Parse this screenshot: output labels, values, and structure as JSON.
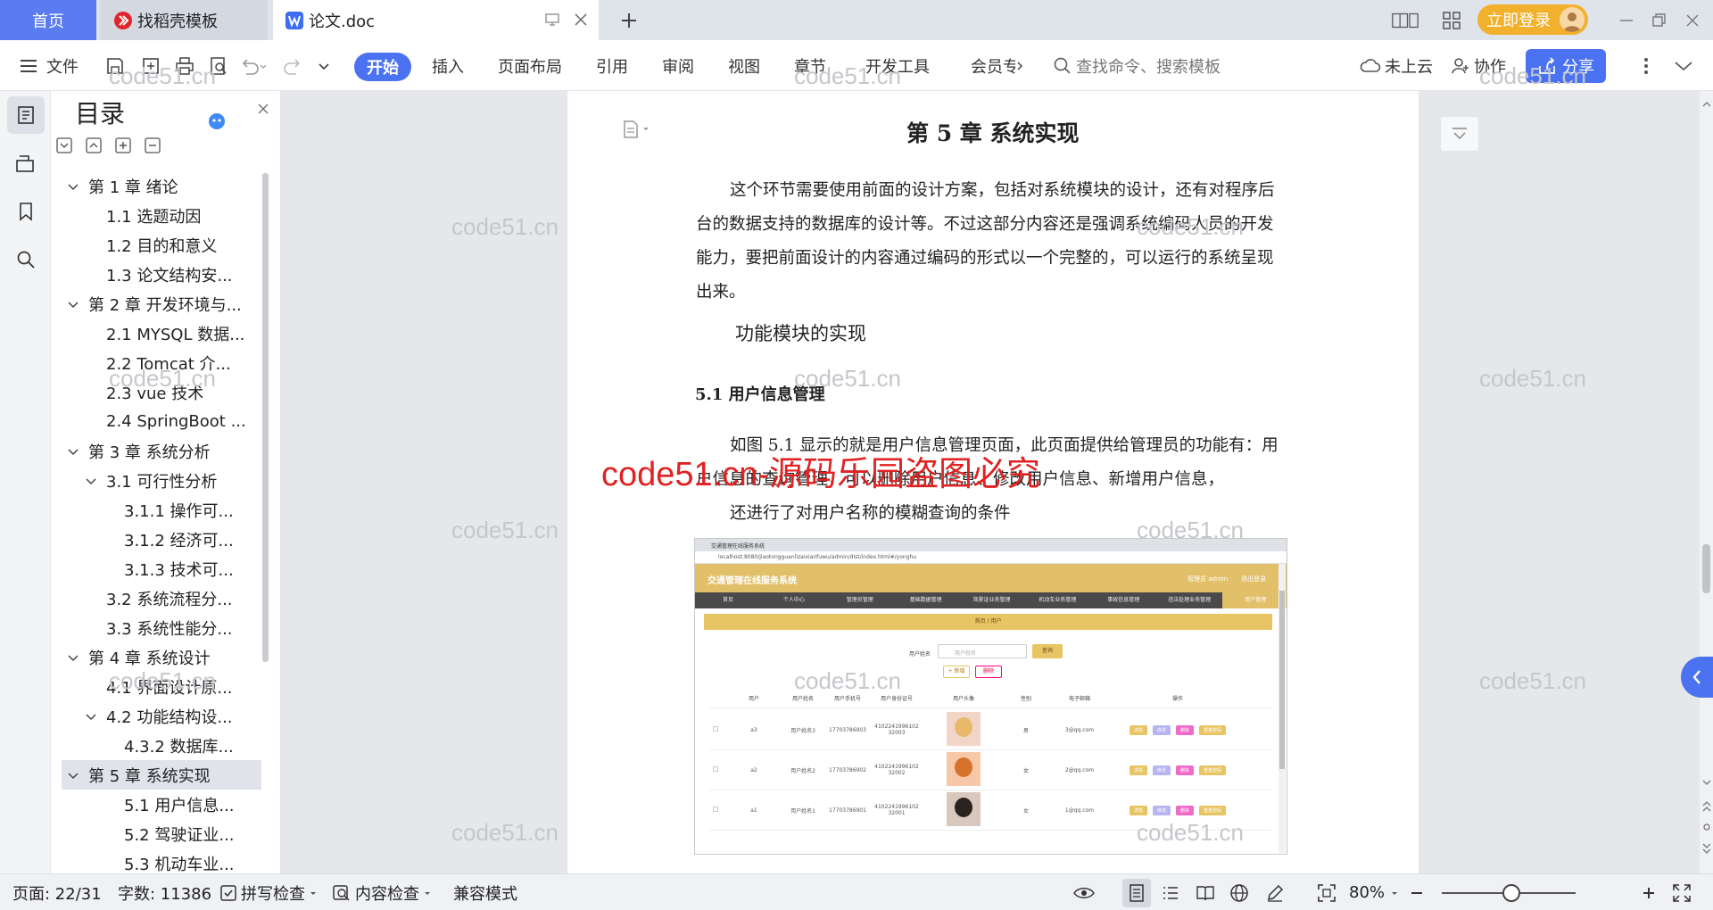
{
  "tabs": {
    "home": "首页",
    "zhaodaoke": "找稻壳模板",
    "doc": "论文.doc",
    "login": "立即登录"
  },
  "toolbar": {
    "file": "文件",
    "menus": [
      "开始",
      "插入",
      "页面布局",
      "引用",
      "审阅",
      "视图",
      "章节",
      "开发工具",
      "会员专"
    ],
    "search_placeholder": "查找命令、搜索模板",
    "cloud": "未上云",
    "collab": "协作",
    "share": "分享"
  },
  "outline": {
    "title": "目录",
    "items": [
      {
        "text": "第 1 章  绪论",
        "level": 1,
        "chev": true
      },
      {
        "text": "1.1 选题动因",
        "level": 2
      },
      {
        "text": "1.2 目的和意义",
        "level": 2
      },
      {
        "text": "1.3 论文结构安...",
        "level": 2
      },
      {
        "text": "第 2 章  开发环境与...",
        "level": 1,
        "chev": true
      },
      {
        "text": "2.1 MYSQL 数据...",
        "level": 2
      },
      {
        "text": "2.2 Tomcat 介...",
        "level": 2
      },
      {
        "text": "2.3 vue 技术",
        "level": 2
      },
      {
        "text": "2.4 SpringBoot ...",
        "level": 2
      },
      {
        "text": "第 3 章  系统分析",
        "level": 1,
        "chev": true
      },
      {
        "text": "3.1 可行性分析",
        "level": 2,
        "chev": true
      },
      {
        "text": "3.1.1 操作可...",
        "level": 3
      },
      {
        "text": "3.1.2 经济可...",
        "level": 3
      },
      {
        "text": "3.1.3 技术可...",
        "level": 3
      },
      {
        "text": "3.2 系统流程分...",
        "level": 2
      },
      {
        "text": "3.3 系统性能分...",
        "level": 2
      },
      {
        "text": "第 4 章  系统设计",
        "level": 1,
        "chev": true
      },
      {
        "text": "4.1 界面设计原...",
        "level": 2
      },
      {
        "text": "4.2 功能结构设...",
        "level": 2,
        "chev": true
      },
      {
        "text": "4.3.2  数据库...",
        "level": 3
      },
      {
        "text": "第 5 章  系统实现",
        "level": 1,
        "chev": true,
        "active": true
      },
      {
        "text": "5.1 用户信息...",
        "level": 3
      },
      {
        "text": "5.2  驾驶证业...",
        "level": 3
      },
      {
        "text": "5.3 机动车业...",
        "level": 3
      }
    ]
  },
  "document": {
    "chapter_title": "第 5 章  系统实现",
    "para1_lines": [
      "这个环节需要使用前面的设计方案，包括对系统模块的设计，还有对程序后",
      "台的数据支持的数据库的设计等。不过这部分内容还是强调系统编码人员的开发",
      "能力，要把前面设计的内容通过编码的形式以一个完整的，可以运行的系统呈现",
      "出来。"
    ],
    "subtitle": "功能模块的实现",
    "section_title": "5.1 用户信息管理",
    "para2_lines": [
      "如图 5.1 显示的就是用户信息管理页面，此页面提供给管理员的功能有：用",
      "户信息的查询管理，可以删除用户信息、修改用户信息、新增用户信息，",
      "还进行了对用户名称的模糊查询的条件"
    ]
  },
  "watermark": {
    "text": "code51.cn",
    "red": "code51.cn-源码乐园盗图必究"
  },
  "screenshot": {
    "tab_title": "交通管理在线服务系统",
    "url": "localhost:8080/jiaotongguanlizaixianfuwu/admin/dist/index.html#/yonghu",
    "app_title": "交通管理在线服务系统",
    "admin": "管理员 admin",
    "logout": "退出登录",
    "nav": [
      "首页",
      "个人中心",
      "管理员管理",
      "基础数据管理",
      "驾驶证业务管理",
      "机动车业务管理",
      "事故信息管理",
      "违法处理业务管理",
      "用户管理"
    ],
    "breadcrumb": "首页 / 用户",
    "search_label": "用户姓名",
    "search_placeholder": "用户姓名",
    "query": "查询",
    "add": "+ 新增",
    "delete": "删除",
    "columns": [
      "用户",
      "用户姓名",
      "用户手机号",
      "用户身份证号",
      "用户头像",
      "性别",
      "电子邮箱",
      "操作"
    ],
    "rows": [
      {
        "user": "a3",
        "name": "用户姓名3",
        "phone": "17703786903",
        "id": "410224199610232003",
        "gender": "男",
        "email": "3@qq.com"
      },
      {
        "user": "a2",
        "name": "用户姓名2",
        "phone": "17703786902",
        "id": "410224199610232002",
        "gender": "女",
        "email": "2@qq.com"
      },
      {
        "user": "a1",
        "name": "用户姓名1",
        "phone": "17703786901",
        "id": "410224199610232001",
        "gender": "女",
        "email": "1@qq.com"
      }
    ],
    "ops": [
      "详情",
      "修改",
      "删除",
      "重置密码"
    ]
  },
  "status": {
    "page": "页面: 22/31",
    "words": "字数: 11386",
    "spell": "拼写检查",
    "content": "内容检查",
    "compat": "兼容模式",
    "zoom": "80%"
  }
}
